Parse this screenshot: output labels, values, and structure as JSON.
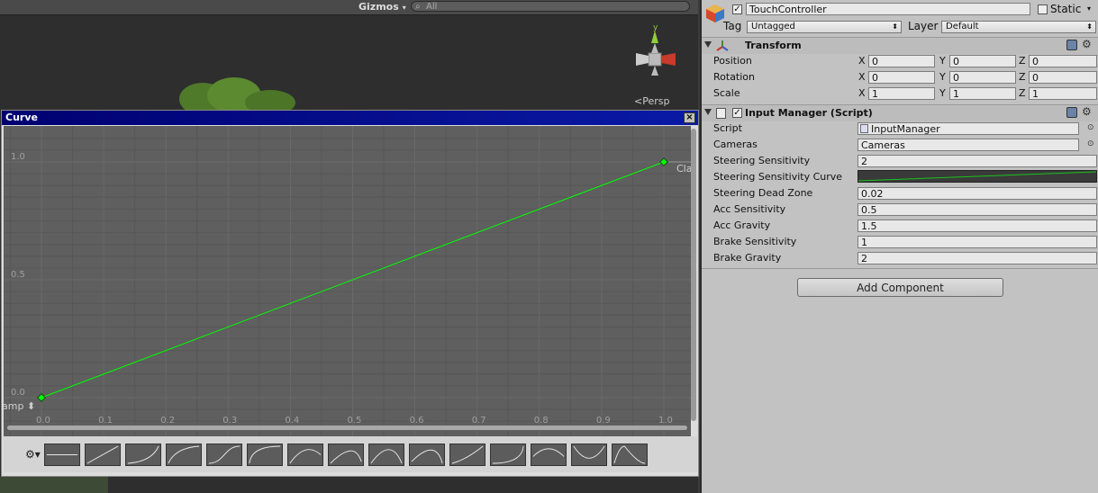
{
  "scene": {
    "gizmos_label": "Gizmos",
    "search_placeholder": "All",
    "persp_label": "Persp"
  },
  "curve_window": {
    "title": "Curve",
    "close_glyph": "×",
    "pre_wrap_label": "amp",
    "post_wrap_label": "Clan",
    "curve_color": "#00ff00",
    "chart_data": {
      "type": "line",
      "x_ticks": [
        "0.0",
        "0.1",
        "0.2",
        "0.3",
        "0.4",
        "0.5",
        "0.6",
        "0.7",
        "0.8",
        "0.9",
        "1.0"
      ],
      "y_ticks": [
        "0.0",
        "0.5",
        "1.0"
      ],
      "xlim": [
        0,
        1
      ],
      "ylim": [
        0,
        1
      ],
      "grid": true,
      "series": [
        {
          "x": [
            0.0,
            1.0
          ],
          "y": [
            0.0,
            1.0
          ]
        }
      ]
    },
    "preset_count": 15
  },
  "inspector": {
    "object_name": "TouchController",
    "static_label": "Static",
    "tag_label": "Tag",
    "tag_value": "Untagged",
    "layer_label": "Layer",
    "layer_value": "Default",
    "transform": {
      "title": "Transform",
      "rows": [
        {
          "label": "Position",
          "x": "0",
          "y": "0",
          "z": "0"
        },
        {
          "label": "Rotation",
          "x": "0",
          "y": "0",
          "z": "0"
        },
        {
          "label": "Scale",
          "x": "1",
          "y": "1",
          "z": "1"
        }
      ]
    },
    "input_manager": {
      "title": "Input Manager (Script)",
      "script_label": "Script",
      "script_value": "InputManager",
      "cameras_label": "Cameras",
      "cameras_value": "Cameras",
      "steering_sensitivity_label": "Steering Sensitivity",
      "steering_sensitivity_value": "2",
      "steering_curve_label": "Steering Sensitivity Curve",
      "steering_dead_zone_label": "Steering Dead Zone",
      "steering_dead_zone_value": "0.02",
      "acc_sensitivity_label": "Acc Sensitivity",
      "acc_sensitivity_value": "0.5",
      "acc_gravity_label": "Acc Gravity",
      "acc_gravity_value": "1.5",
      "brake_sensitivity_label": "Brake Sensitivity",
      "brake_sensitivity_value": "1",
      "brake_gravity_label": "Brake Gravity",
      "brake_gravity_value": "2"
    },
    "add_component_label": "Add Component"
  }
}
